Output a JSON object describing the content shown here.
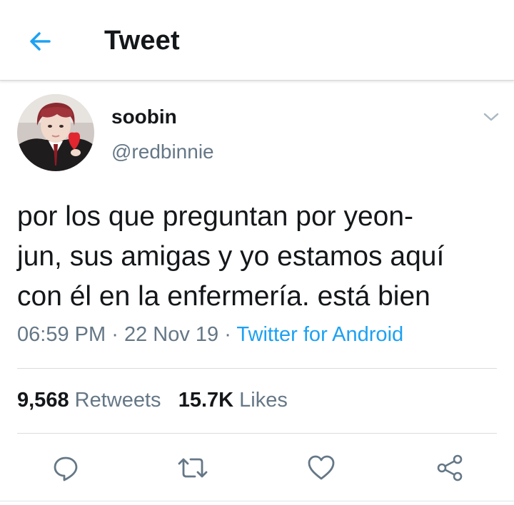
{
  "header": {
    "title": "Tweet"
  },
  "colors": {
    "accent": "#1da1f2",
    "secondary_text": "#657786",
    "primary_text": "#14171a"
  },
  "author": {
    "display_name": "soobin",
    "handle": "@redbinnie"
  },
  "tweet": {
    "lines": [
      "por los que preguntan por yeon-",
      "jun, sus amigas y yo estamos aquí",
      "con él en la enfermería. está bien"
    ],
    "time": "06:59 PM",
    "date": "22 Nov 19",
    "separator": "·",
    "source": "Twitter for Android"
  },
  "stats": {
    "retweets_count": "9,568",
    "retweets_label": "Retweets",
    "likes_count": "15.7K",
    "likes_label": "Likes"
  },
  "actions": {
    "icons": [
      "reply-icon",
      "retweet-icon",
      "like-icon",
      "share-icon"
    ]
  }
}
